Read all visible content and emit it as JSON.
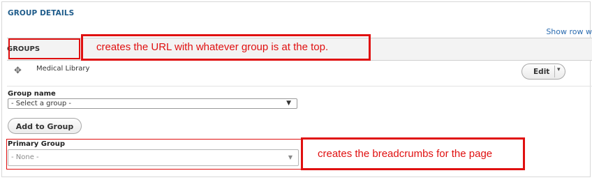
{
  "section": {
    "title": "GROUP DETAILS",
    "show_row_weights": "Show row w"
  },
  "groups_table": {
    "header": "GROUPS",
    "rows": [
      {
        "name": "Medical Library",
        "edit_label": "Edit"
      }
    ]
  },
  "group_name": {
    "label": "Group name",
    "selected": "- Select a group -"
  },
  "add_button": "Add to Group",
  "primary_group": {
    "label": "Primary Group",
    "selected": "- None -"
  },
  "annotations": {
    "top": "creates the URL with whatever group is at the top.",
    "bottom": "creates the breadcrumbs for the page"
  },
  "colors": {
    "annotation": "#e01010",
    "link": "#2b6cb0",
    "section_title": "#1f5c8b"
  },
  "icons": {
    "drag": "drag-handle-icon",
    "caret": "chevron-down-icon"
  }
}
